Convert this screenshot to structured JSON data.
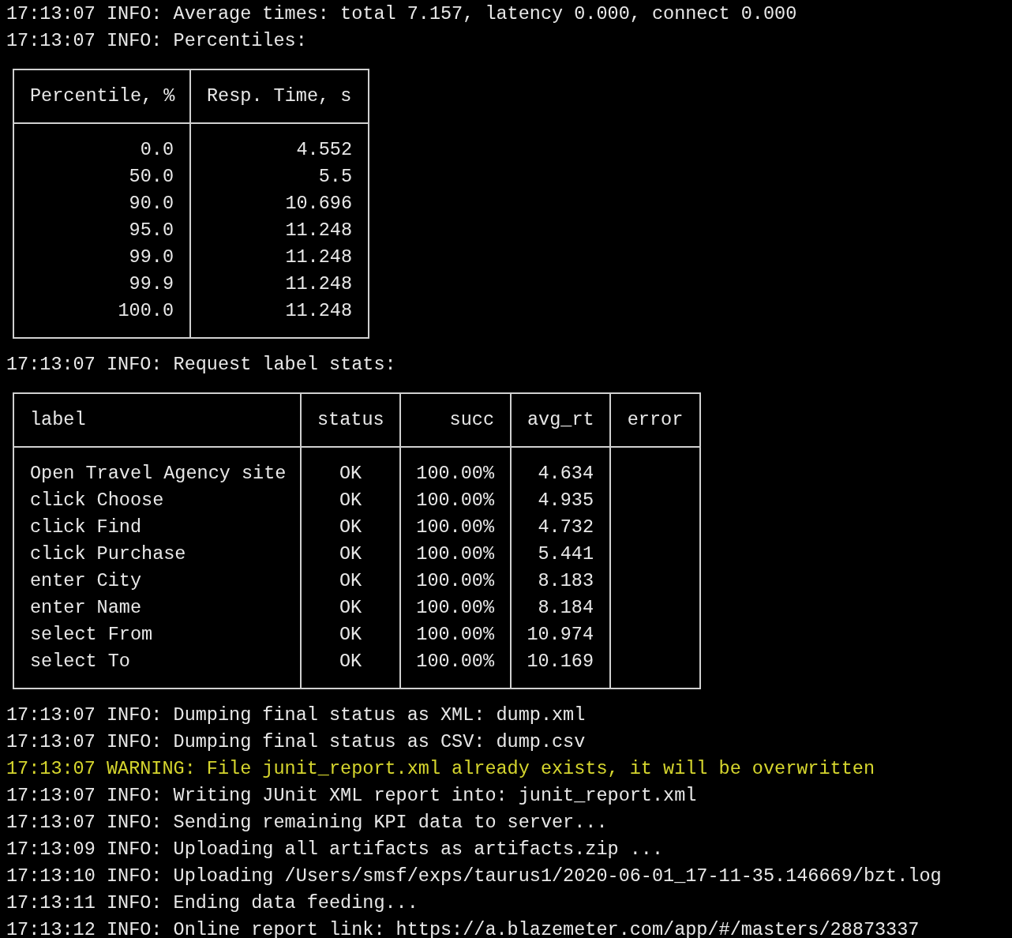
{
  "log_top": [
    {
      "kind": "info",
      "text": "17:13:07 INFO: Average times: total 7.157, latency 0.000, connect 0.000"
    },
    {
      "kind": "info",
      "text": "17:13:07 INFO: Percentiles:"
    }
  ],
  "percentiles_table": {
    "columns": [
      "Percentile, %",
      "Resp. Time, s"
    ],
    "rows": [
      [
        "0.0",
        "4.552"
      ],
      [
        "50.0",
        "5.5"
      ],
      [
        "90.0",
        "10.696"
      ],
      [
        "95.0",
        "11.248"
      ],
      [
        "99.0",
        "11.248"
      ],
      [
        "99.9",
        "11.248"
      ],
      [
        "100.0",
        "11.248"
      ]
    ]
  },
  "log_middle": [
    {
      "kind": "info",
      "text": "17:13:07 INFO: Request label stats:"
    }
  ],
  "label_stats_table": {
    "columns": [
      "label",
      "status",
      "succ",
      "avg_rt",
      "error"
    ],
    "rows": [
      [
        "Open Travel Agency site",
        "OK",
        "100.00%",
        "4.634"
      ],
      [
        "click Choose",
        "OK",
        "100.00%",
        "4.935"
      ],
      [
        "click Find",
        "OK",
        "100.00%",
        "4.732"
      ],
      [
        "click Purchase",
        "OK",
        "100.00%",
        "5.441"
      ],
      [
        "enter City",
        "OK",
        "100.00%",
        "8.183"
      ],
      [
        "enter Name",
        "OK",
        "100.00%",
        "8.184"
      ],
      [
        "select From",
        "OK",
        "100.00%",
        "10.974"
      ],
      [
        "select To",
        "OK",
        "100.00%",
        "10.169"
      ]
    ]
  },
  "log_bottom": [
    {
      "kind": "info",
      "text": "17:13:07 INFO: Dumping final status as XML: dump.xml"
    },
    {
      "kind": "info",
      "text": "17:13:07 INFO: Dumping final status as CSV: dump.csv"
    },
    {
      "kind": "warning",
      "text": "17:13:07 WARNING: File junit_report.xml already exists, it will be overwritten"
    },
    {
      "kind": "info",
      "text": "17:13:07 INFO: Writing JUnit XML report into: junit_report.xml"
    },
    {
      "kind": "info",
      "text": "17:13:07 INFO: Sending remaining KPI data to server..."
    },
    {
      "kind": "info",
      "text": "17:13:09 INFO: Uploading all artifacts as artifacts.zip ..."
    },
    {
      "kind": "info",
      "text": "17:13:10 INFO: Uploading /Users/smsf/exps/taurus1/2020-06-01_17-11-35.146669/bzt.log"
    },
    {
      "kind": "info",
      "text": "17:13:11 INFO: Ending data feeding..."
    },
    {
      "kind": "info",
      "text": "17:13:12 INFO: Online report link: https://a.blazemeter.com/app/#/masters/28873337"
    }
  ]
}
